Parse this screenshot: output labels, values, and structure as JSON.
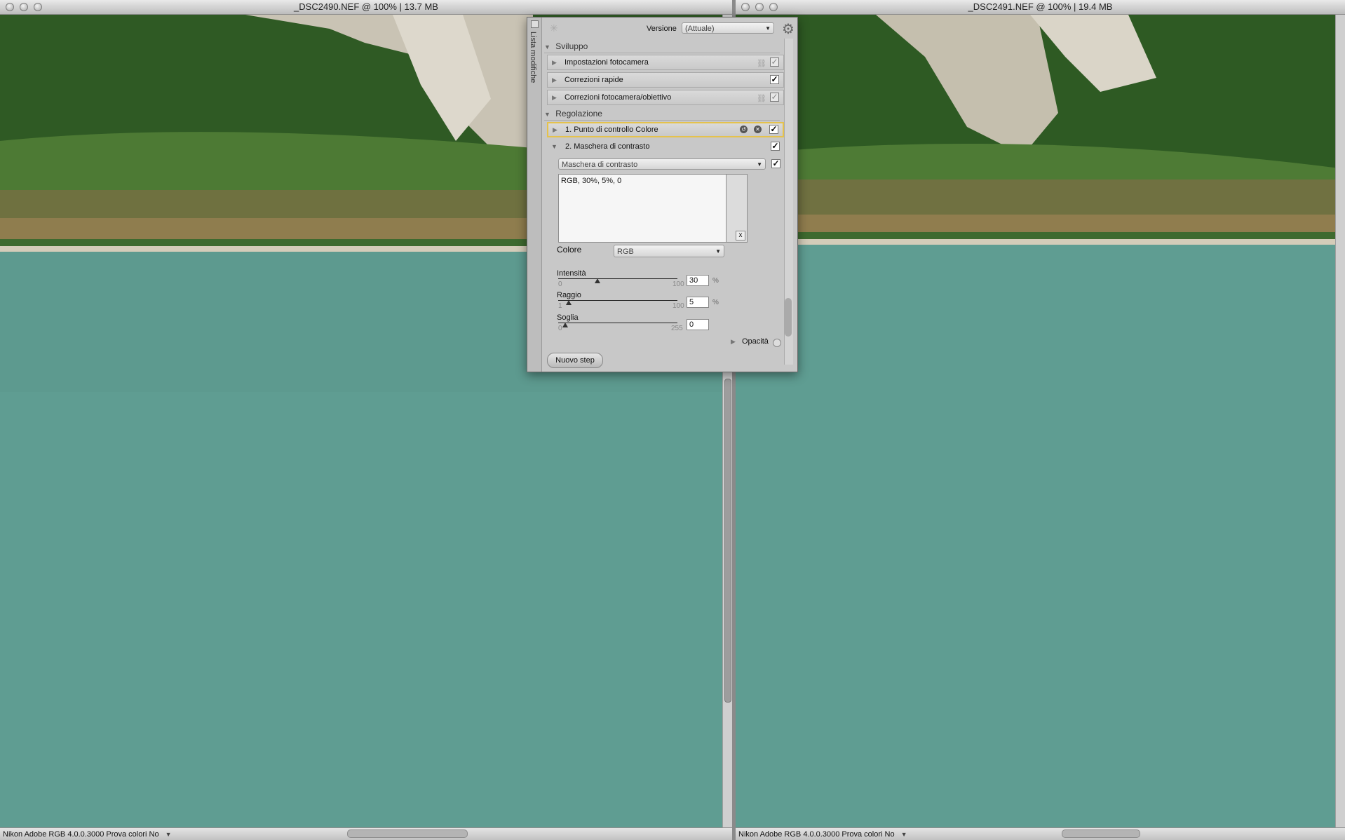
{
  "windows": {
    "left": {
      "title": "_DSC2490.NEF @ 100% | 13.7 MB",
      "status": "Nikon Adobe RGB 4.0.0.3000  Prova colori No"
    },
    "right": {
      "title": "_DSC2491.NEF @ 100% | 19.4 MB",
      "status": "Nikon Adobe RGB 4.0.0.3000  Prova colori No"
    }
  },
  "panel": {
    "side_tab": "Lista modifiche",
    "version_label": "Versione",
    "version_value": "(Attuale)",
    "sviluppo": {
      "title": "Sviluppo",
      "items": [
        {
          "label": "Impostazioni fotocamera",
          "checked": true,
          "enabled": false
        },
        {
          "label": "Correzioni rapide",
          "checked": true,
          "enabled": true
        },
        {
          "label": "Correzioni fotocamera/obiettivo",
          "checked": true,
          "enabled": false
        }
      ]
    },
    "regolazione": {
      "title": "Regolazione",
      "items": [
        {
          "label": "1. Punto di controllo Colore"
        },
        {
          "label": "2. Maschera di contrasto"
        }
      ],
      "filter_select": "Maschera di contrasto",
      "summary": "RGB, 30%, 5%, 0",
      "colore_label": "Colore",
      "colore_value": "RGB",
      "intensita": {
        "label": "Intensità",
        "min": "0",
        "max": "100",
        "value": "30",
        "unit": "%"
      },
      "raggio": {
        "label": "Raggio",
        "min": "1",
        "max": "100",
        "value": "5",
        "unit": "%"
      },
      "soglia": {
        "label": "Soglia",
        "min": "0",
        "max": "255",
        "value": "0"
      },
      "opacita_label": "Opacità"
    },
    "new_step_button": "Nuovo step"
  },
  "colors": {
    "lake": "#5f9d92",
    "forest": "#2f5a24",
    "highlight": "#e5c24d"
  }
}
